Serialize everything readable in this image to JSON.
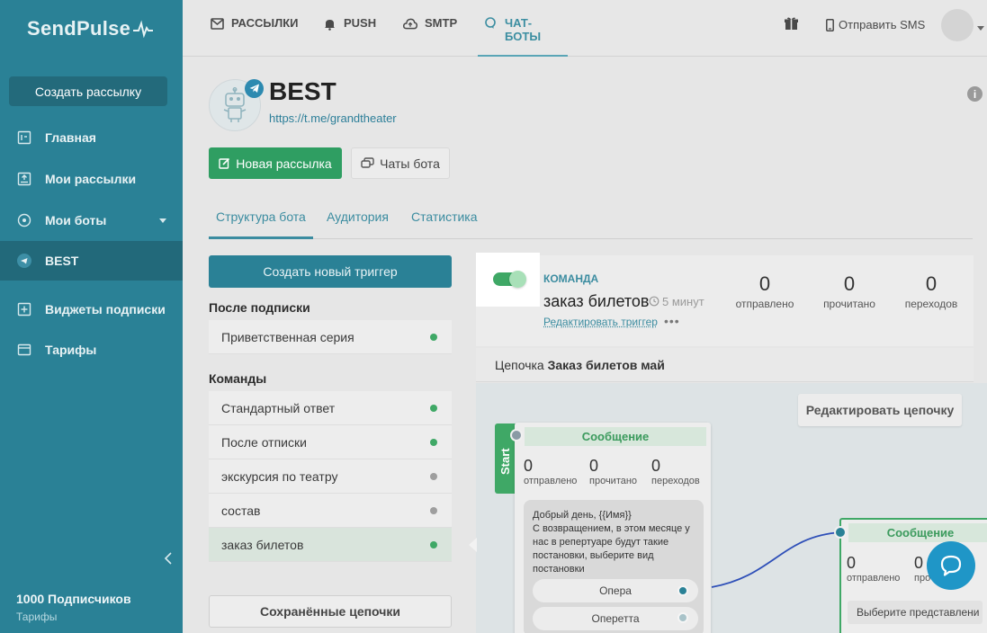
{
  "sidebar": {
    "logo": "SendPulse",
    "create_button": "Создать рассылку",
    "items": [
      {
        "label": "Главная",
        "icon": "home-icon"
      },
      {
        "label": "Мои рассылки",
        "icon": "mail-upload-icon"
      },
      {
        "label": "Мои боты",
        "icon": "bot-icon"
      },
      {
        "label": "BEST",
        "icon": "telegram-icon"
      },
      {
        "label": "Виджеты подписки",
        "icon": "widget-icon"
      },
      {
        "label": "Тарифы",
        "icon": "card-icon"
      }
    ],
    "subscribers": "1000 Подписчиков",
    "tariffs_link": "Тарифы"
  },
  "topbar": {
    "tabs": [
      {
        "label": "РАССЫЛКИ",
        "icon": "envelope-icon"
      },
      {
        "label": "PUSH",
        "icon": "bell-icon"
      },
      {
        "label": "SMTP",
        "icon": "cloud-upload-icon"
      },
      {
        "label": "ЧАТ-БОТЫ",
        "icon": "chat-icon"
      }
    ],
    "active_tab": "ЧАТ-БОТЫ",
    "sms_label": "Отправить SMS"
  },
  "bot": {
    "name": "BEST",
    "link": "https://t.me/grandtheater",
    "new_mailing": "Новая рассылка",
    "bot_chats": "Чаты бота"
  },
  "subtabs": [
    "Структура бота",
    "Аудитория",
    "Статистика"
  ],
  "left_panel": {
    "create_trigger": "Создать новый триггер",
    "after_subscribe_heading": "После подписки",
    "after_subscribe_items": [
      {
        "label": "Приветственная серия",
        "status": "active"
      }
    ],
    "commands_heading": "Команды",
    "commands": [
      {
        "label": "Стандартный ответ",
        "status": "active"
      },
      {
        "label": "После отписки",
        "status": "active"
      },
      {
        "label": "экскурсия по театру",
        "status": "inactive"
      },
      {
        "label": "состав",
        "status": "inactive"
      },
      {
        "label": "заказ билетов",
        "status": "active"
      }
    ],
    "selected_command": "заказ билетов",
    "saved_chains": "Сохранённые цепочки"
  },
  "trigger": {
    "type_label": "КОМАНДА",
    "name": "заказ билетов",
    "time": "5 минут",
    "edit_link": "Редактировать триггер",
    "more": "•••",
    "stats": [
      {
        "value": "0",
        "label": "отправлено"
      },
      {
        "value": "0",
        "label": "прочитано"
      },
      {
        "value": "0",
        "label": "переходов"
      }
    ]
  },
  "chain": {
    "prefix": "Цепочка",
    "name": "Заказ билетов май",
    "edit_button": "Редактировать цепочку"
  },
  "flow": {
    "start_label": "Start",
    "node1": {
      "title": "Сообщение",
      "stats": [
        {
          "value": "0",
          "label": "отправлено"
        },
        {
          "value": "0",
          "label": "прочитано"
        },
        {
          "value": "0",
          "label": "переходов"
        }
      ],
      "message_lines": [
        "Добрый день, {{Имя}}",
        "С возвращением, в этом месяце у",
        "нас в репертуаре будут такие",
        "постановки, выберите вид",
        "постановки"
      ],
      "buttons": [
        "Опера",
        "Оперетта"
      ]
    },
    "node2": {
      "title": "Сообщение",
      "stats": [
        {
          "value": "0",
          "label": "отправлено"
        },
        {
          "value": "0",
          "label": "про"
        }
      ],
      "button": "Выберите представлени"
    }
  },
  "colors": {
    "sidebar": "#2a8196",
    "accent": "#3b8ca0",
    "green": "#3fa866",
    "inactive": "#9e9e9e"
  }
}
